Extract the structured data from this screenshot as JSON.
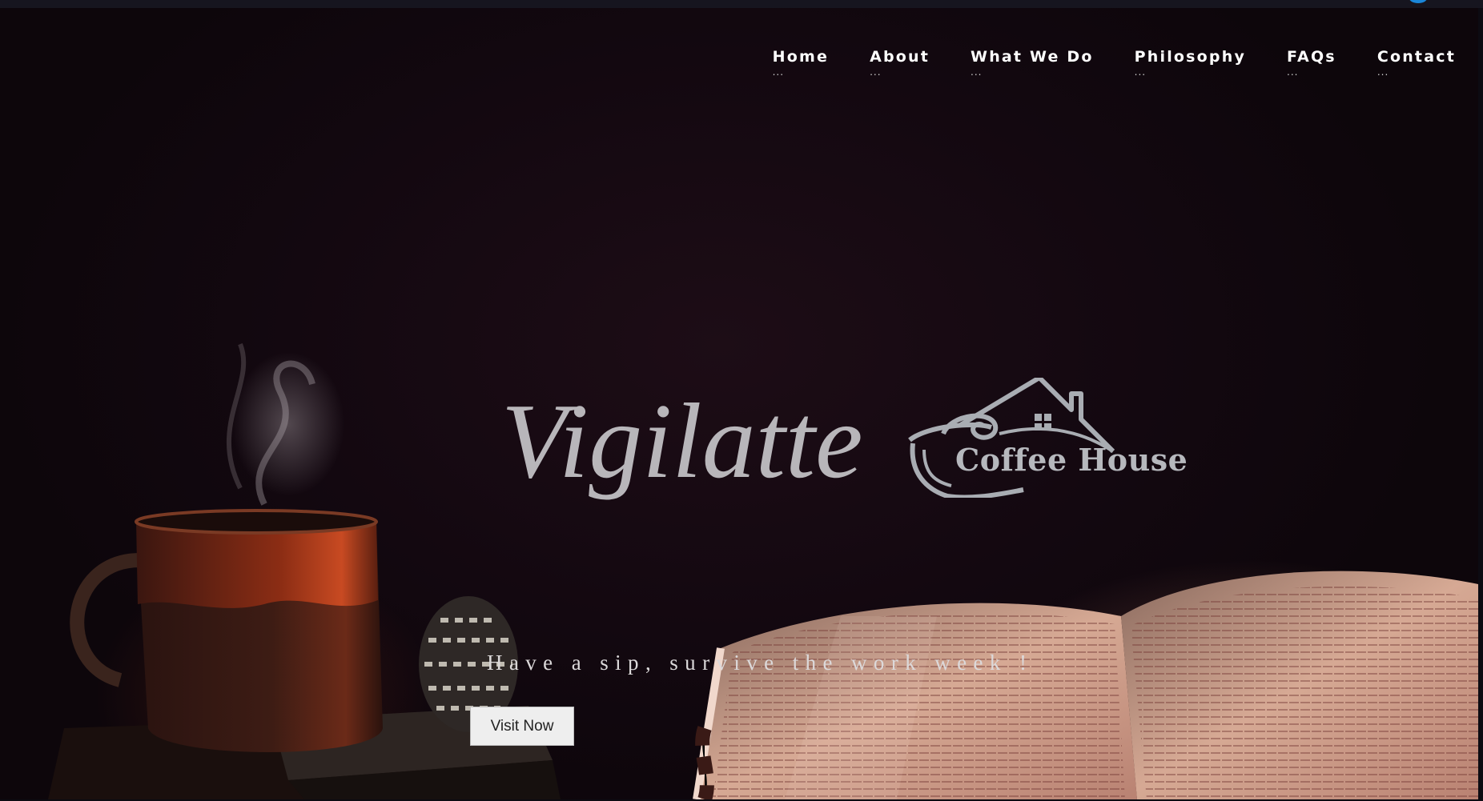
{
  "nav": {
    "items": [
      {
        "label": "Home",
        "dots": "..."
      },
      {
        "label": "About",
        "dots": "..."
      },
      {
        "label": "What We Do",
        "dots": "..."
      },
      {
        "label": "Philosophy",
        "dots": "..."
      },
      {
        "label": "FAQs",
        "dots": "..."
      },
      {
        "label": "Contact",
        "dots": "..."
      }
    ]
  },
  "hero": {
    "brand_name": "Vigilatte",
    "logo_text": "Coffee House",
    "tagline": "Have a sip, survive the work week !",
    "cta_label": "Visit Now"
  },
  "colors": {
    "background": "#130810",
    "brand_text": "#b8b6ba",
    "nav_text": "#ffffff",
    "button_bg": "#eeeeee",
    "mug_glaze": "#b8401f"
  },
  "icons": [
    "coffee-house-logo-icon"
  ]
}
